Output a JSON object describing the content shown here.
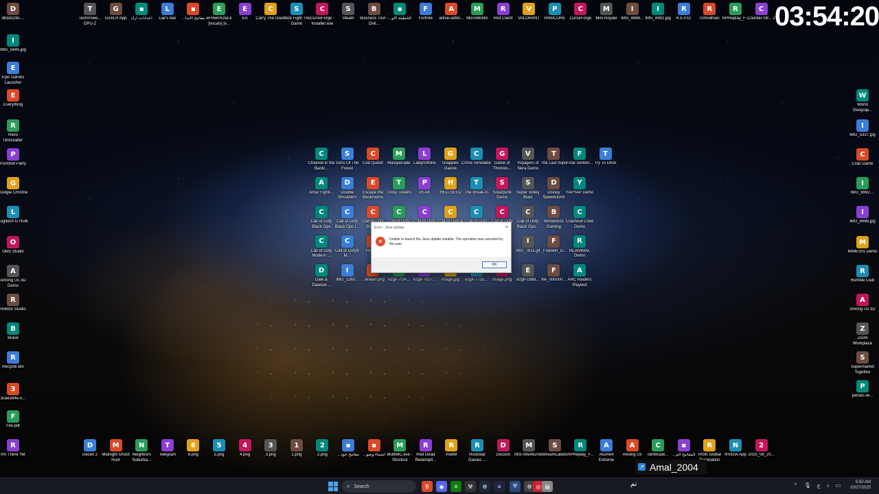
{
  "clock": "03:54:20",
  "top_row": [
    "TechPowe... GPU-Z",
    "GoXLR App",
    "اعدادات ارك",
    "Liar's Bar",
    "...مفاتيح الاندا",
    "eFRw0XcluLk [vocals] [v...",
    "EA",
    "Carry The Glass",
    "Stick Fight The Game",
    "CurseForge - Installer.exe",
    "Steam",
    "Business Tour - Onli...",
    "...الخطيئة الاو",
    "Fortnite",
    "arkse-settin...",
    "MicroWorks",
    "Riot Client",
    "VALORANT",
    "PANICORE",
    "CurseForge",
    "Mini Royale",
    "IMG_8988...",
    "IMG_8992.jpg",
    "R.E.P.O.",
    "r2modman",
    "RPReplay_F...",
    "Counter-Str... 2"
  ],
  "left_col": [
    "db3d228c-...",
    "IMG_5645.jpg",
    "Epic Games Launcher",
    "Everything",
    "Revo Uninstaller",
    "Pummel Party",
    "Google Chrome",
    "Logitech G HUB",
    "OBS Studio",
    "Among Us 3D Demo",
    "Roblox Studio",
    "Brave",
    "Recycle Bin",
    "3cae284e-5...",
    "File.pdf",
    "RV There Yet"
  ],
  "right_col": [
    "World Geograp...",
    "IMG_5337.jpg",
    "Crab Game",
    "IMG_8992....",
    "IMG_8988.jpg",
    "MIMESIS Demo",
    "Rumble Club",
    "Among Us 3D",
    "Zoom Workplace",
    "Supermarket Together",
    "parsec-wi..."
  ],
  "grid_row1": [
    "Chained in the Backr...",
    "Sons Of The Forest",
    "Cod Quest!",
    "Masquerade",
    "Labyrinthine",
    "Grapples Galore",
    "Crime Simulator",
    "Game of Thrones...",
    "Voyagers of Nera Demo",
    "The Last hope",
    "Final Senten...",
    "Try To Drive"
  ],
  "grid_row2": [
    "Amar Fighti...",
    "Double Shoulders",
    "Escape the Backrooms",
    "Tricky Towers",
    "PEAK",
    "HELLSEED",
    "The Break-In",
    "Solarpunk Demo",
    "Super Volley Blast",
    "Disney Speedstorm",
    "YAPYAP Demo"
  ],
  "grid_row3": [
    "Call of Duty Black Ops",
    "Call of Duty Black Ops I...",
    "Call of Duty Black...",
    "Call of Duty",
    "Call of Duty",
    "Call of Duty 4",
    "Call of Duty",
    "Call of Duty",
    "Call of Duty Black Ops...",
    "Borderless Gaming",
    "Crashout Crew Demo"
  ],
  "grid_row4": [
    "Call of Duty Modern ...",
    "Call of Duty® M...",
    "Roblo...",
    "",
    "",
    "",
    "",
    "",
    "IMG_7611.gif",
    "_Franklin_D...",
    "REANIMAL Demo"
  ],
  "grid_row5": [
    "Dale & Dawson...",
    "IMG_1260...",
    "...eraser.png",
    "ezgif-7f24...",
    "ezgif-7027...",
    "image.jpg",
    "ezgif-7735...",
    "image.png",
    "ezgif-18bd...",
    "file_000000...",
    "ARC Raiders Playtest"
  ],
  "bottom_row": [
    "Deceit 2",
    "Midnight Ghost Hunt",
    "Neighbors Suburba...",
    "Telegram",
    "6.png",
    "5.png",
    "4.png",
    "3.png",
    "1.png",
    "2.png",
    "...مفاتيح جود",
    "...اسماء وصو",
    "MultiMC.exe - Shortcut",
    "Red Dead Redempti...",
    "RedM",
    "Rockstar Games ...",
    "Discord",
    "MSI Afterburner",
    "StreamLabels",
    "RPReplay_F...",
    "AIDA64 Extreme",
    "Among Us",
    "certificate...",
    "...المفاتيح الم",
    "RISK Global Domination",
    "NVIDIA App",
    "2025_08_20..."
  ],
  "dialog": {
    "title": "Error - Java Update",
    "message": "Unable to launch the Java Update installer. The operation was canceled by the user.",
    "ok": "OK",
    "close": "×"
  },
  "overlay_name": "Amal_2004",
  "taskbar": {
    "search": "Search",
    "left_glyph": "نم",
    "time": "5:50 AM",
    "date": "10/27/2025",
    "tray_char": "ع"
  },
  "colors": {
    "accent": "#4aa3f0",
    "error": "#e04b2b"
  }
}
